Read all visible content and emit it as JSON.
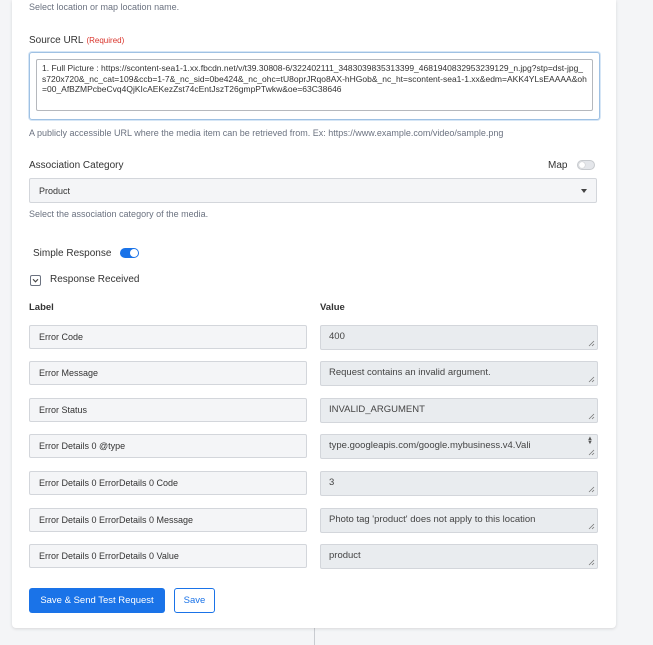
{
  "top_hint": "Select location or map location name.",
  "source_url": {
    "label": "Source URL",
    "required": "(Required)",
    "value": "1. Full Picture : https://scontent-sea1-1.xx.fbcdn.net/v/t39.30808-6/322402111_3483039835313399_4681940832953239129_n.jpg?stp=dst-jpg_s720x720&_nc_cat=109&ccb=1-7&_nc_sid=0be424&_nc_ohc=tU8oprJRqo8AX-hHGob&_nc_ht=scontent-sea1-1.xx&edm=AKK4YLsEAAAA&oh=00_AfBZMPcbeCvq4QjKIcAEKezZst74cEntJszT26gmpPTwkw&oe=63C38646",
    "hint": "A publicly accessible URL where the media item can be retrieved from. Ex: https://www.example.com/video/sample.png"
  },
  "association": {
    "label": "Association Category",
    "map_label": "Map",
    "map_enabled": false,
    "selected": "Product",
    "hint": "Select the association category of the media."
  },
  "simple_response": {
    "label": "Simple Response",
    "enabled": true
  },
  "response_received": {
    "label": "Response Received",
    "expanded": true
  },
  "table": {
    "label_header": "Label",
    "value_header": "Value",
    "rows": [
      {
        "label": "Error Code",
        "value": "400"
      },
      {
        "label": "Error Message",
        "value": "Request contains an invalid argument."
      },
      {
        "label": "Error Status",
        "value": "INVALID_ARGUMENT"
      },
      {
        "label": "Error Details 0 @type",
        "value": "type.googleapis.com/google.mybusiness.v4.Vali"
      },
      {
        "label": "Error Details 0 ErrorDetails 0 Code",
        "value": "3"
      },
      {
        "label": "Error Details 0 ErrorDetails 0 Message",
        "value": "Photo tag 'product' does not apply to this location"
      },
      {
        "label": "Error Details 0 ErrorDetails 0 Value",
        "value": "product"
      }
    ]
  },
  "buttons": {
    "save_send": "Save & Send Test Request",
    "save": "Save"
  },
  "colors": {
    "primary": "#1a73e8",
    "required": "#d9342b"
  }
}
